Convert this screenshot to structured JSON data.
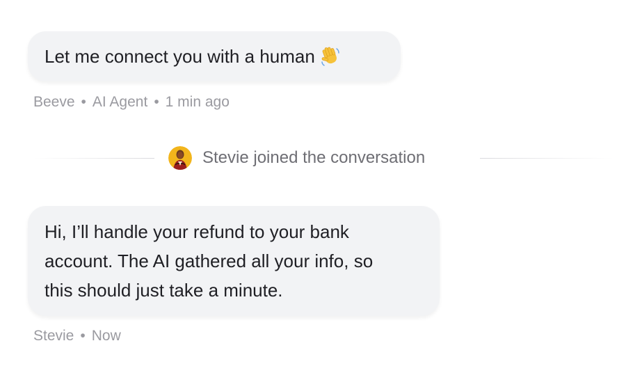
{
  "messages": [
    {
      "text": "Let me connect you with a human",
      "emoji": "waving-hand",
      "sender": "Beeve",
      "role": "AI Agent",
      "time": "1 min ago"
    },
    {
      "lines": [
        "Hi, I’ll handle your refund to your bank",
        "account. The AI gathered all your info, so",
        "this should just take a minute."
      ],
      "sender": "Stevie",
      "time": "Now"
    }
  ],
  "event": {
    "text": "Stevie joined the conversation",
    "avatar_icon": "user-avatar"
  },
  "separator": "•",
  "colors": {
    "bubble_bg": "#f2f3f5",
    "text": "#1f1f24",
    "meta": "#9a9aa0",
    "event_text": "#6e6e74",
    "avatar_bg": "#f2b51c"
  }
}
